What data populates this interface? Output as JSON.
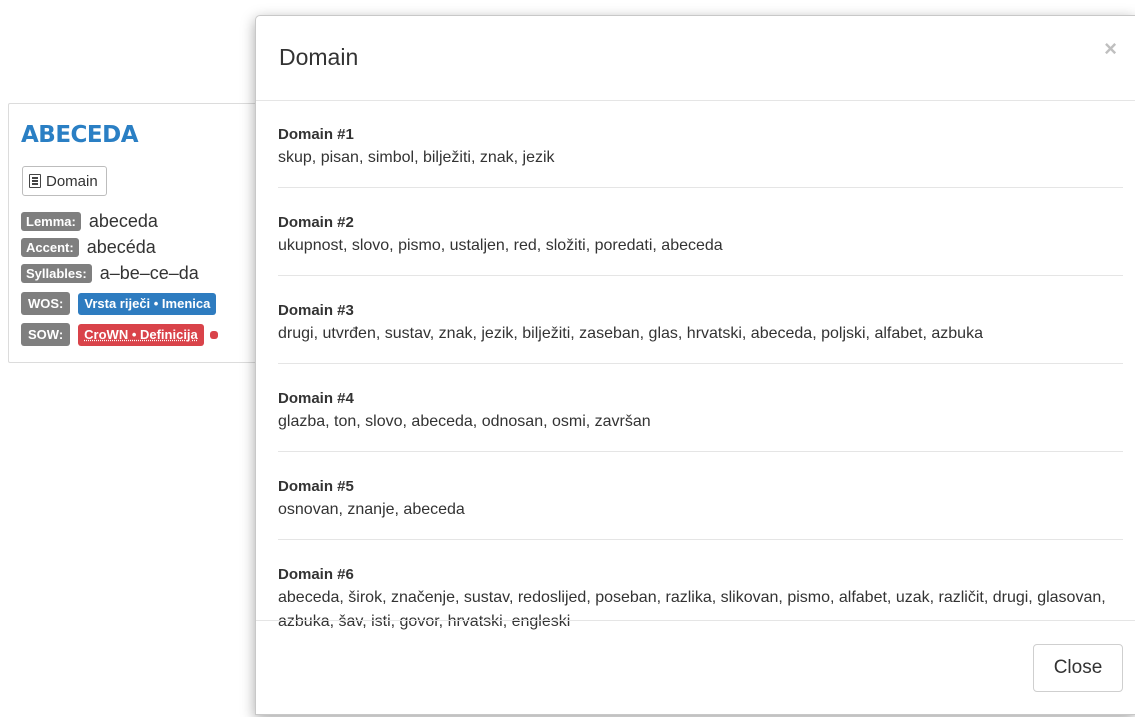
{
  "card": {
    "title": "ABECEDA",
    "domain_button": "Domain",
    "lemma_label": "Lemma:",
    "lemma_value": "abeceda",
    "accent_label": "Accent:",
    "accent_value": "abecéda",
    "syllables_label": "Syllables:",
    "syllables_value": "a–be–ce–da",
    "wos_label": "WOS:",
    "wos_tag": "Vrsta riječi • Imenica",
    "sow_label": "SOW:",
    "sow_tag": "CroWN • Definicija"
  },
  "modal": {
    "title": "Domain",
    "close_icon": "×",
    "close_button": "Close",
    "domains": [
      {
        "title": "Domain #1",
        "words": "skup, pisan, simbol, bilježiti, znak, jezik"
      },
      {
        "title": "Domain #2",
        "words": "ukupnost, slovo, pismo, ustaljen, red, složiti, poredati, abeceda"
      },
      {
        "title": "Domain #3",
        "words": "drugi, utvrđen, sustav, znak, jezik, bilježiti, zaseban, glas, hrvatski, abeceda, poljski, alfabet, azbuka"
      },
      {
        "title": "Domain #4",
        "words": "glazba, ton, slovo, abeceda, odnosan, osmi, završan"
      },
      {
        "title": "Domain #5",
        "words": "osnovan, znanje, abeceda"
      },
      {
        "title": "Domain #6",
        "words": "abeceda, širok, značenje, sustav, redoslijed, poseban, razlika, slikovan, pismo, alfabet, uzak, različit, drugi, glasovan, azbuka, šav, isti, govor, hrvatski, engleski"
      }
    ]
  }
}
